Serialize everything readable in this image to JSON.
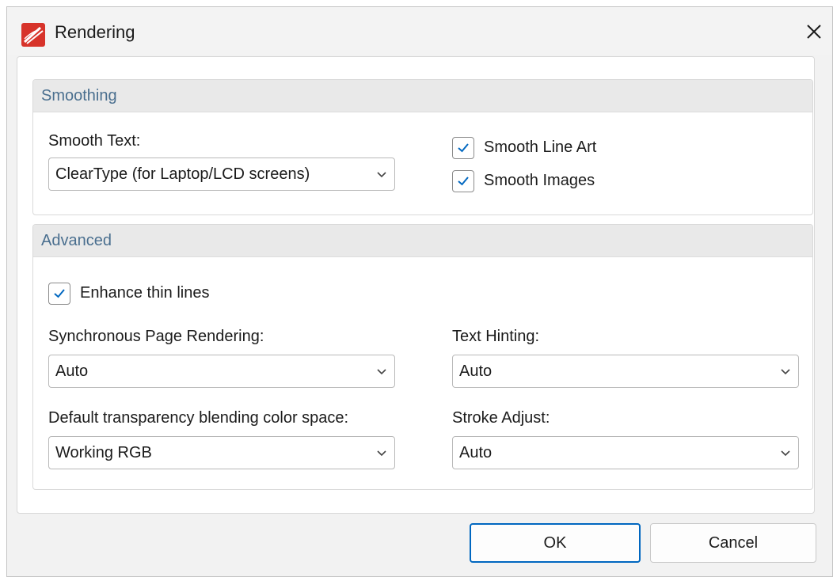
{
  "window": {
    "title": "Rendering"
  },
  "smoothing": {
    "header": "Smoothing",
    "smooth_text_label": "Smooth Text:",
    "smooth_text_value": "ClearType (for Laptop/LCD screens)",
    "smooth_line_art_label": "Smooth Line Art",
    "smooth_line_art_checked": true,
    "smooth_images_label": "Smooth Images",
    "smooth_images_checked": true
  },
  "advanced": {
    "header": "Advanced",
    "enhance_thin_lines_label": "Enhance thin lines",
    "enhance_thin_lines_checked": true,
    "sync_rendering_label": "Synchronous Page Rendering:",
    "sync_rendering_value": "Auto",
    "text_hinting_label": "Text Hinting:",
    "text_hinting_value": "Auto",
    "blend_space_label": "Default transparency blending color space:",
    "blend_space_value": "Working RGB",
    "stroke_adjust_label": "Stroke Adjust:",
    "stroke_adjust_value": "Auto"
  },
  "buttons": {
    "ok": "OK",
    "cancel": "Cancel"
  },
  "icons": {
    "app": "pdf-app-icon",
    "close": "close-icon",
    "dropdown": "chevron-down-icon",
    "check": "checkmark-icon"
  },
  "colors": {
    "accent": "#0067c0",
    "group_header_text": "#4a6f8f",
    "app_icon": "#d7332a"
  }
}
